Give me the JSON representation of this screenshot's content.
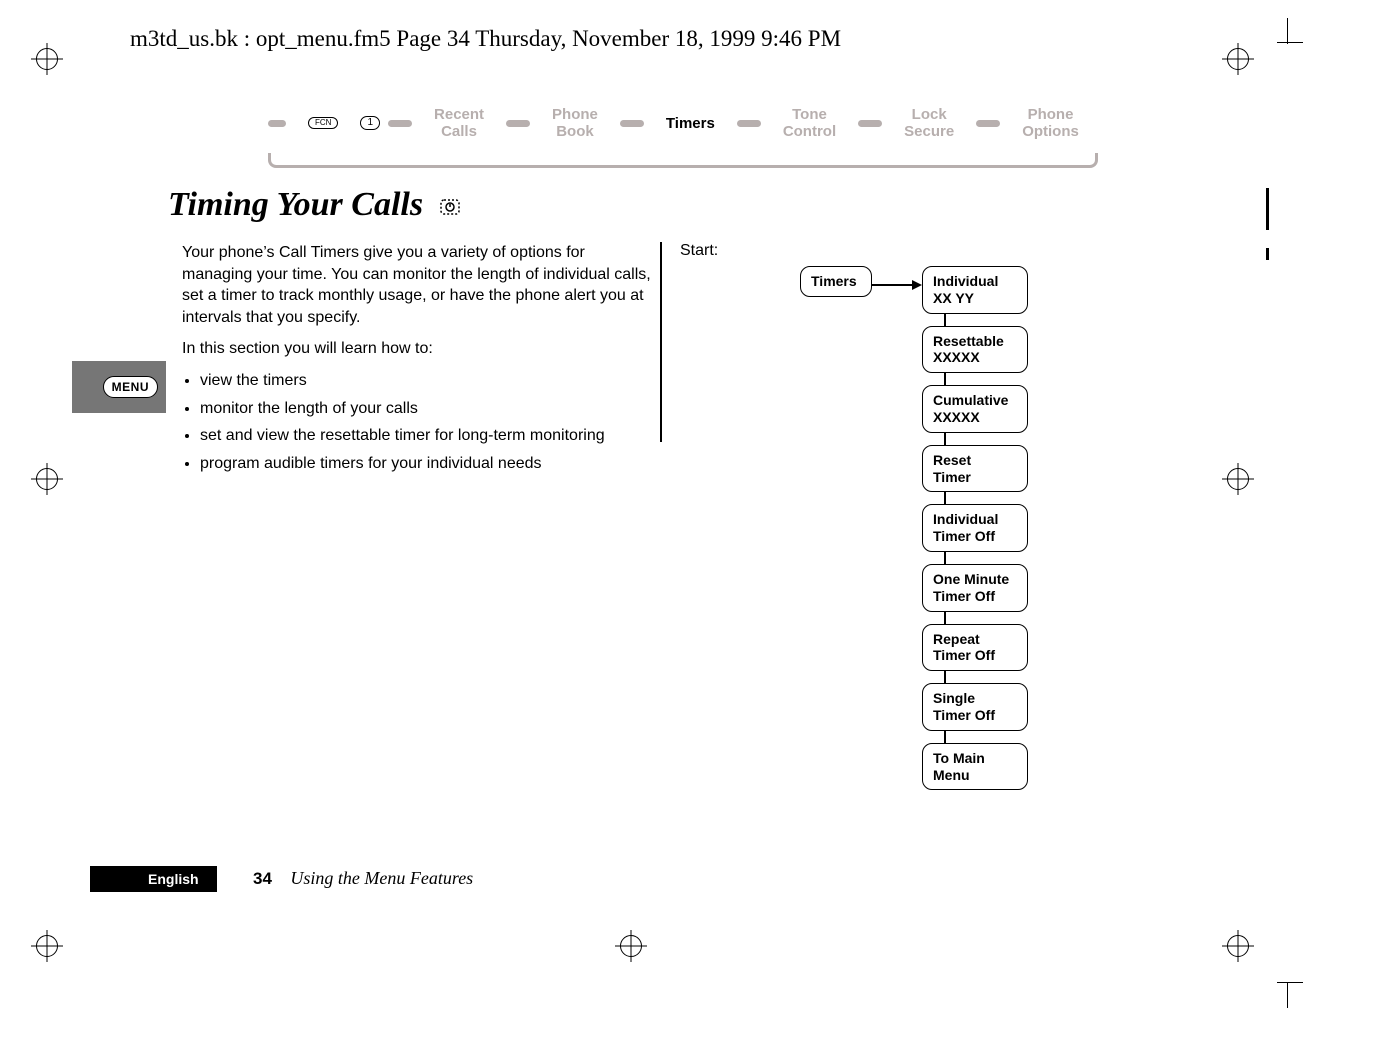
{
  "running_header": "m3td_us.bk : opt_menu.fm5  Page 34  Thursday, November 18, 1999  9:46 PM",
  "breadcrumb": {
    "button_fcn": "FCN",
    "button_one": "1",
    "items": [
      {
        "label": "Recent\nCalls",
        "active": false
      },
      {
        "label": "Phone\nBook",
        "active": false
      },
      {
        "label": "Timers",
        "active": true
      },
      {
        "label": "Tone\nControl",
        "active": false
      },
      {
        "label": "Lock\nSecure",
        "active": false
      },
      {
        "label": "Phone\nOptions",
        "active": false
      }
    ]
  },
  "title": "Timing Your Calls",
  "title_icon": "timer-icon",
  "intro_para": "Your phone’s Call Timers give you a variety of options for managing your time. You can monitor the length of individual calls, set a timer to track monthly usage, or have the phone alert you at intervals that you specify.",
  "learn_lead": "In this section you will learn how to:",
  "learn_items": [
    "view the timers",
    "monitor the length of your calls",
    "set and view the resettable timer for long-term monitoring",
    "program audible timers for your individual needs"
  ],
  "sidetab_label": "MENU",
  "start_label": "Start:",
  "flow": {
    "root": "Timers",
    "nodes": [
      {
        "line1": "Individual",
        "line2": "XX YY"
      },
      {
        "line1": "Resettable",
        "line2": "XXXXX"
      },
      {
        "line1": "Cumulative",
        "line2": "XXXXX"
      },
      {
        "line1": "Reset",
        "line2": "Timer"
      },
      {
        "line1": "Individual",
        "line2": "Timer Off"
      },
      {
        "line1": "One Minute",
        "line2": "Timer Off"
      },
      {
        "line1": "Repeat",
        "line2": "Timer Off"
      },
      {
        "line1": "Single",
        "line2": "Timer Off"
      },
      {
        "line1": "To Main",
        "line2": "Menu"
      }
    ]
  },
  "footer": {
    "language": "English",
    "page_number": "34",
    "chapter": "Using the Menu Features"
  }
}
